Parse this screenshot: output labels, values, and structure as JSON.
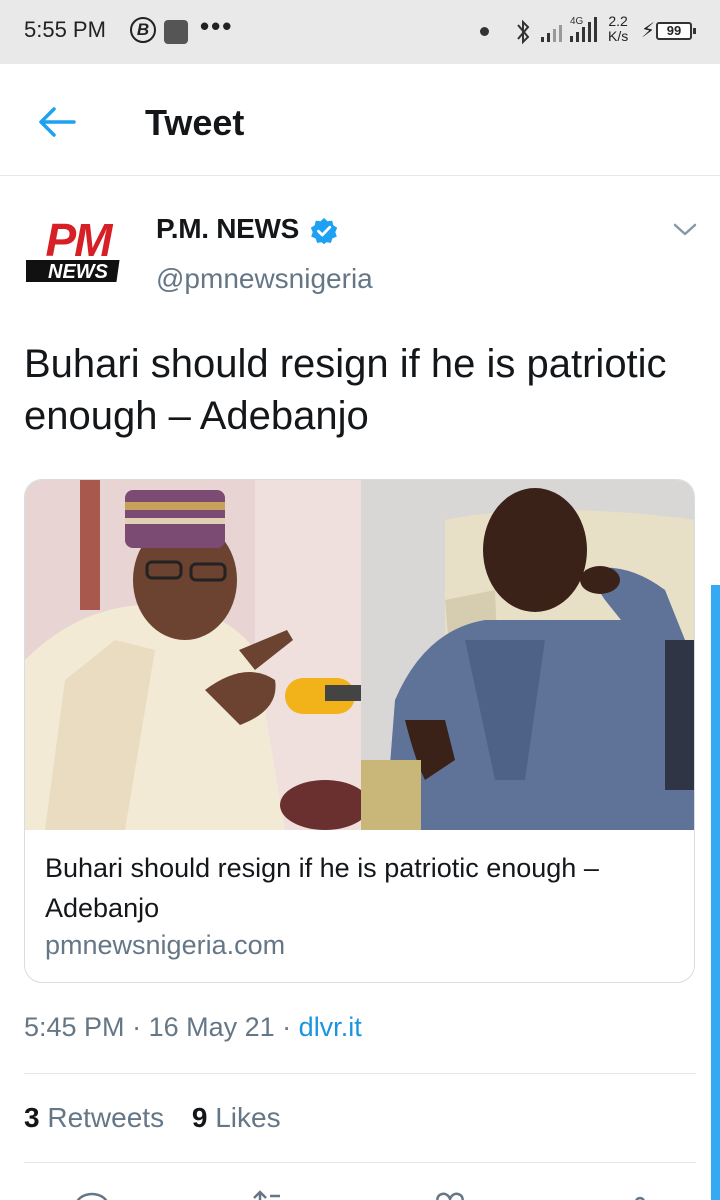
{
  "status_bar": {
    "time": "5:55 PM",
    "b_icon_letter": "B",
    "more": "•••",
    "network_type": "4G",
    "speed_value": "2.2",
    "speed_unit": "K/s",
    "battery": "99"
  },
  "header": {
    "title": "Tweet",
    "back_icon": "arrow-left-icon"
  },
  "tweet": {
    "avatar_text_top": "PM",
    "avatar_text_bottom": "NEWS",
    "author_name": "P.M. NEWS",
    "handle": "@pmnewsnigeria",
    "text": "Buhari should resign if he is patriotic enough – Adebanjo",
    "card": {
      "title": "Buhari should resign if he is patriotic enough – Adebanjo",
      "domain": "pmnewsnigeria.com"
    },
    "time": "5:45 PM",
    "date": "16 May 21",
    "source": "dlvr.it",
    "retweets_count": "3",
    "retweets_label": "Retweets",
    "likes_count": "9",
    "likes_label": "Likes"
  },
  "colors": {
    "accent": "#1da1f2",
    "link": "#1b95e0",
    "secondary_text": "#657786",
    "divider": "#e1e8ed",
    "avatar_red": "#d71f26"
  }
}
